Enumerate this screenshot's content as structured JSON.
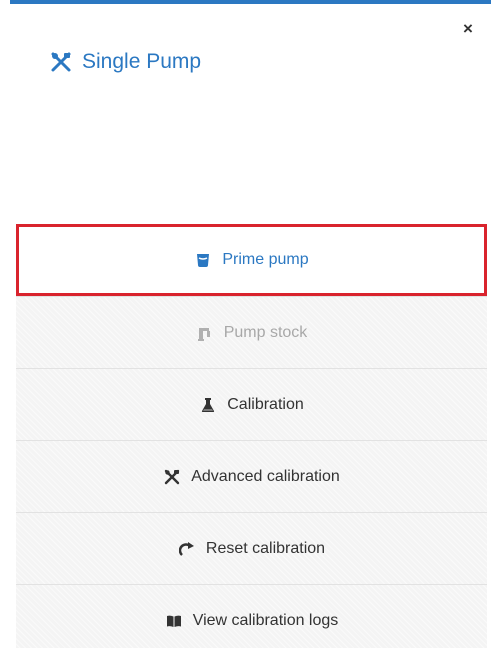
{
  "dialog": {
    "title": "Single Pump",
    "close_label": "×"
  },
  "menu": {
    "items": [
      {
        "label": "Prime pump",
        "icon": "beaker-icon",
        "state": "selected"
      },
      {
        "label": "Pump stock",
        "icon": "pump-icon",
        "state": "disabled"
      },
      {
        "label": "Calibration",
        "icon": "flask-icon",
        "state": "normal"
      },
      {
        "label": "Advanced calibration",
        "icon": "tools-icon",
        "state": "normal"
      },
      {
        "label": "Reset calibration",
        "icon": "redo-icon",
        "state": "normal"
      },
      {
        "label": "View calibration logs",
        "icon": "book-icon",
        "state": "normal"
      }
    ]
  },
  "colors": {
    "accent": "#2b78c2",
    "highlight_border": "#d9232d",
    "text": "#333333",
    "disabled_text": "#a8a8a8"
  }
}
